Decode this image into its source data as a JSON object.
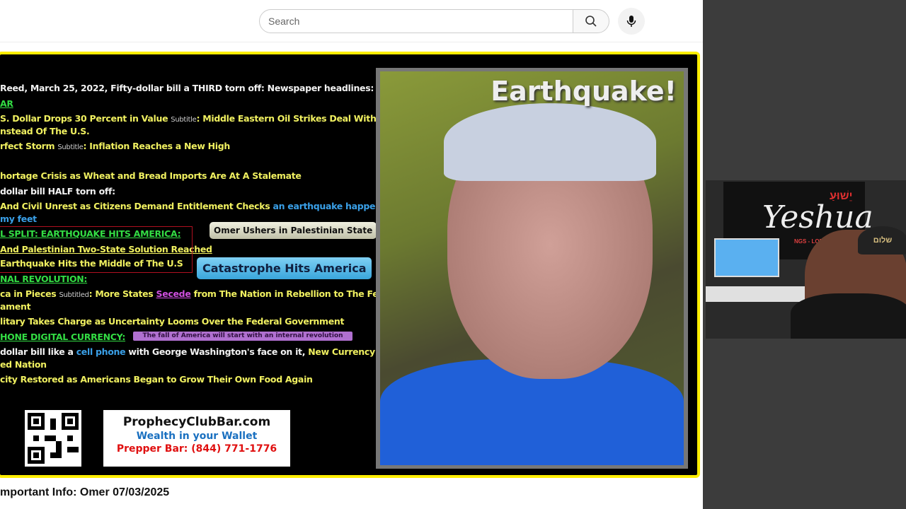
{
  "search": {
    "placeholder": "Search"
  },
  "slide": {
    "lines": [
      [
        {
          "t": "Reed, March 25, 2022, Fifty-dollar bill a THIRD torn off: Newspaper headlines:",
          "c": "w"
        }
      ],
      [
        {
          "t": "AR",
          "c": "g"
        }
      ],
      [
        {
          "t": "S. Dollar Drops 30 Percent in Value ",
          "c": "y"
        },
        {
          "t": "Subtitle",
          "c": "s"
        },
        {
          "t": ": Middle Eastern Oil Strikes Deal With",
          "c": "y"
        }
      ],
      [
        {
          "t": "nstead Of The U.S.",
          "c": "y"
        }
      ],
      [
        {
          "t": "rfect Storm ",
          "c": "y"
        },
        {
          "t": "Subtitle",
          "c": "s"
        },
        {
          "t": ": Inflation Reaches a New High",
          "c": "y"
        }
      ],
      [
        {
          "t": "hortage Crisis as Wheat and Bread Imports Are At A Stalemate",
          "c": "y"
        }
      ],
      [
        {
          "t": "dollar bill HALF torn off:",
          "c": "w"
        }
      ],
      [
        {
          "t": "And Civil Unrest as Citizens Demand Entitlement Checks ",
          "c": "y"
        },
        {
          "t": "an earthquake happened",
          "c": "b"
        }
      ],
      [
        {
          "t": " my feet",
          "c": "b"
        }
      ],
      [
        {
          "t": "L SPLIT: EARTHQUAKE HITS AMERICA:",
          "c": "g"
        }
      ],
      [
        {
          "t": "And Palestinian Two-State Solution Reached",
          "c": "y u"
        }
      ],
      [
        {
          "t": "Earthquake Hits the Middle of The U.S",
          "c": "y"
        }
      ],
      [
        {
          "t": "NAL REVOLUTION:",
          "c": "g"
        }
      ],
      [
        {
          "t": "ca in Pieces  ",
          "c": "y"
        },
        {
          "t": "Subtitled",
          "c": "s"
        },
        {
          "t": ": More States ",
          "c": "y"
        },
        {
          "t": "Secede",
          "c": "m"
        },
        {
          "t": " from The Nation in Rebellion to The Federal",
          "c": "y"
        }
      ],
      [
        {
          "t": "ament",
          "c": "y"
        }
      ],
      [
        {
          "t": "litary Takes Charge as Uncertainty Looms Over the Federal Government",
          "c": "y"
        }
      ],
      [
        {
          "t": "HONE DIGITAL CURRENCY:",
          "c": "g"
        }
      ],
      [
        {
          "t": "dollar bill like a ",
          "c": "w"
        },
        {
          "t": "cell phone",
          "c": "b"
        },
        {
          "t": " with George Washington's face on it, ",
          "c": "w"
        },
        {
          "t": "New Currency for A",
          "c": "y"
        }
      ],
      [
        {
          "t": "ed Nation",
          "c": "y"
        }
      ],
      [
        {
          "t": "city Restored as Americans Began to Grow Their Own Food Again",
          "c": "y"
        }
      ]
    ],
    "callout_palestinian": "Omer Ushers in Palestinian State",
    "callout_catastrophe": "Catastrophe Hits America",
    "callout_fall": "The fall of America will start with an internal revolution",
    "ad_site": "ProphecyClubBar.com",
    "ad_tagline": "Wealth in your Wallet",
    "ad_phone": "Prepper Bar: (844) 771-1776",
    "inset_caption": "Earthquake!"
  },
  "video_title": "mportant Info: Omer 07/03/2025",
  "webcam": {
    "banner": "Yeshua",
    "hebrew": "יֵשׁוּעַ",
    "banner_sub": "NGS - LORD OF LORDS",
    "cap": "שלום"
  }
}
